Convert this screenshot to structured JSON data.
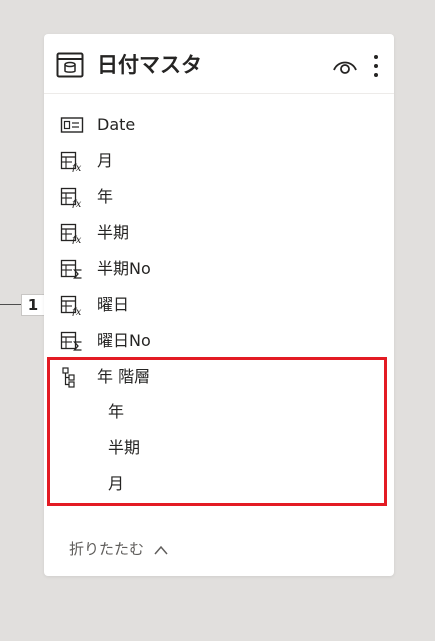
{
  "connector": {
    "cardinality": "1"
  },
  "card": {
    "title": "日付マスタ",
    "header_icons": [
      "table-icon",
      "eye-icon",
      "more-vertical-icon"
    ]
  },
  "fields": [
    {
      "label": "Date",
      "icon": "date-field-icon"
    },
    {
      "label": "月",
      "icon": "calculated-column-icon"
    },
    {
      "label": "年",
      "icon": "calculated-column-icon"
    },
    {
      "label": "半期",
      "icon": "calculated-column-icon"
    },
    {
      "label": "半期No",
      "icon": "sum-column-icon"
    },
    {
      "label": "曜日",
      "icon": "calculated-column-icon"
    },
    {
      "label": "曜日No",
      "icon": "sum-column-icon"
    }
  ],
  "hierarchy": {
    "label": "年 階層",
    "icon": "hierarchy-icon",
    "levels": [
      "年",
      "半期",
      "月"
    ]
  },
  "footer": {
    "collapse_label": "折りたたむ",
    "icon": "chevron-up-icon"
  },
  "colors": {
    "canvas": "#e1dfdd",
    "card": "#ffffff",
    "text": "#252423",
    "muted_text": "#605e5c",
    "highlight": "#e31b23"
  }
}
